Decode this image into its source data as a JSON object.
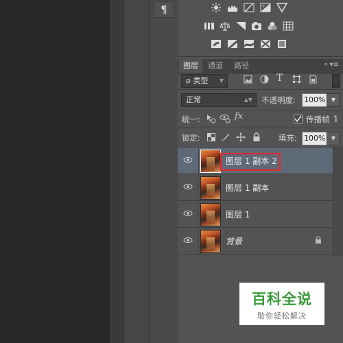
{
  "toolbar_strip": {
    "paragraph_glyph": "¶"
  },
  "adjustments": {
    "icons": [
      "brightness-contrast-icon",
      "levels-icon",
      "curves-icon",
      "exposure-icon",
      "vibrance-icon",
      "hue-saturation-icon",
      "color-balance-icon",
      "black-white-icon",
      "photo-filter-icon",
      "channel-mixer-icon",
      "color-lookup-icon",
      "invert-icon",
      "posterize-icon",
      "threshold-icon",
      "selective-color-icon",
      "gradient-map-icon"
    ]
  },
  "tabs": [
    {
      "label": "图层",
      "active": true
    },
    {
      "label": "通道",
      "active": false
    },
    {
      "label": "路径",
      "active": false
    }
  ],
  "filter": {
    "label": "ρ 类型"
  },
  "blend_mode": {
    "value": "正常"
  },
  "opacity": {
    "label": "不透明度:",
    "value": "100%"
  },
  "unify": {
    "label": "统一:",
    "propagate_label": "传播帧",
    "propagate_value": "1"
  },
  "lock": {
    "label": "锁定:",
    "fill_label": "填充:",
    "fill_value": "100%"
  },
  "layers": [
    {
      "name": "图层 1 副本 2",
      "selected": true
    },
    {
      "name": "图层 1 副本",
      "selected": false
    },
    {
      "name": "图层 1",
      "selected": false
    },
    {
      "name": "背景",
      "selected": false,
      "locked": true
    }
  ],
  "watermark": {
    "brand": "百科全说",
    "tagline": "助你轻松解决"
  }
}
